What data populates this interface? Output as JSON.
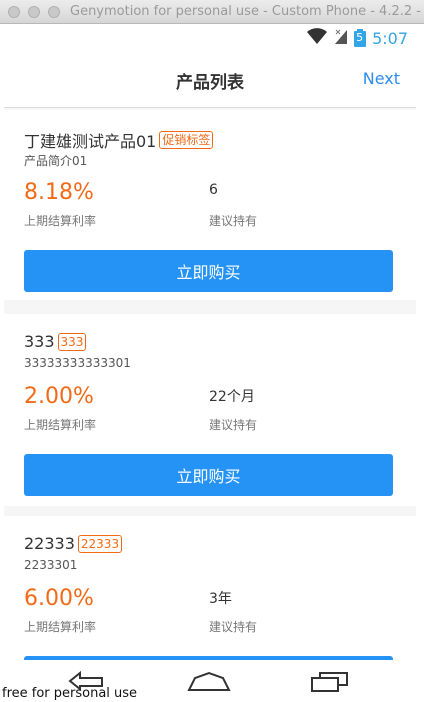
{
  "window": {
    "title": "Genymotion for personal use - Custom Phone - 4.2.2 - AP"
  },
  "status_bar": {
    "time": "5:07",
    "battery": "5"
  },
  "header": {
    "title": "产品列表",
    "next_label": "Next"
  },
  "products": [
    {
      "name": "丁建雄测试产品01",
      "tag": "促销标签",
      "description": "产品简介01",
      "rate": "8.18%",
      "rate_label": "上期结算利率",
      "term": "6",
      "term_label": "建议持有",
      "button_label": "立即购买"
    },
    {
      "name": "333",
      "tag": "333",
      "description": "33333333333301",
      "rate": "2.00%",
      "rate_label": "上期结算利率",
      "term": "22个月",
      "term_label": "建议持有",
      "button_label": "立即购买"
    },
    {
      "name": "22333",
      "tag": "22333",
      "description": "2233301",
      "rate": "6.00%",
      "rate_label": "上期结算利率",
      "term": "3年",
      "term_label": "建议持有",
      "button_label": ""
    }
  ],
  "watermark": "free for personal use",
  "colors": {
    "accent_blue": "#2592f5",
    "rate_orange": "#f26a17",
    "next_blue": "#2d8cf0"
  }
}
